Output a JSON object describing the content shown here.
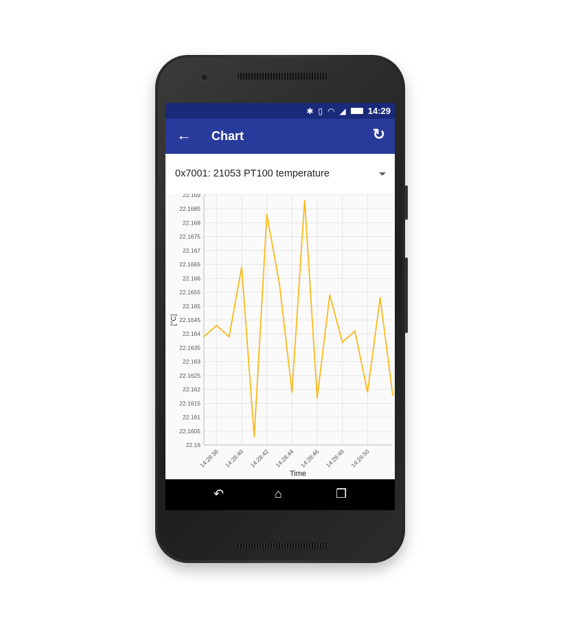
{
  "status_bar": {
    "time": "14:29",
    "icons": [
      "bluetooth-icon",
      "vibrate-icon",
      "wifi-icon",
      "signal-icon",
      "battery-icon"
    ]
  },
  "app_bar": {
    "title": "Chart",
    "back_icon": "arrow-left-icon",
    "refresh_icon": "refresh-icon",
    "color": "#283a9a"
  },
  "selector": {
    "value": "0x7001: 21053 PT100 temperature"
  },
  "nav_bar": {
    "icons": [
      "back-icon",
      "home-icon",
      "recents-icon"
    ]
  },
  "chart_data": {
    "type": "line",
    "xlabel": "Time",
    "ylabel": "[°C]",
    "ylim": [
      22.16,
      22.169
    ],
    "yticks": [
      "22.16",
      "22.1605",
      "22.161",
      "22.1615",
      "22.162",
      "22.1625",
      "22.163",
      "22.1635",
      "22.164",
      "22.1645",
      "22.165",
      "22.1655",
      "22.166",
      "22.1665",
      "22.167",
      "22.1675",
      "22.168",
      "22.1685",
      "22.169"
    ],
    "xticks": [
      "14:28:38",
      "14:28:40",
      "14:28:42",
      "14:28:44",
      "14:28:46",
      "14:28:48",
      "14:28:50"
    ],
    "x": [
      "14:28:37",
      "14:28:38",
      "14:28:39",
      "14:28:40",
      "14:28:41",
      "14:28:42",
      "14:28:43",
      "14:28:44",
      "14:28:45",
      "14:28:46",
      "14:28:47",
      "14:28:48",
      "14:28:49",
      "14:28:50",
      "14:28:51",
      "14:28:52"
    ],
    "values": [
      22.1639,
      22.1643,
      22.1639,
      22.1664,
      22.1603,
      22.1683,
      22.1658,
      22.1619,
      22.1688,
      22.1617,
      22.1654,
      22.1637,
      22.1641,
      22.1619,
      22.1653,
      22.1618
    ],
    "line_color": "#fbb917",
    "grid": true
  }
}
